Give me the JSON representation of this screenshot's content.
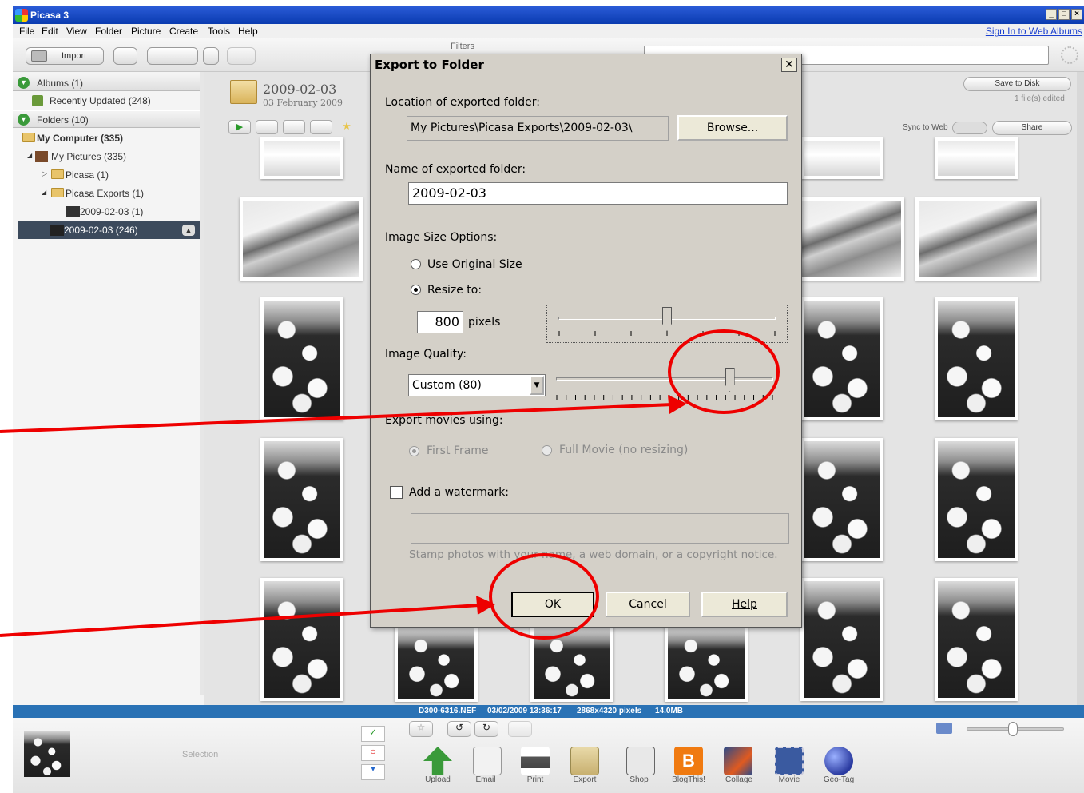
{
  "window": {
    "title": "Picasa 3"
  },
  "menu": {
    "items": [
      "File",
      "Edit",
      "View",
      "Folder",
      "Picture",
      "Create",
      "Tools",
      "Help"
    ],
    "sign_in": "Sign In to Web Albums"
  },
  "toolbar": {
    "import_label": "Import",
    "filters_label": "Filters"
  },
  "sidebar": {
    "albums_header": "Albums (1)",
    "recently_updated": "Recently Updated (248)",
    "folders_header": "Folders (10)",
    "my_computer": "My Computer (335)",
    "my_pictures": "My Pictures (335)",
    "picasa": "Picasa (1)",
    "picasa_exports": "Picasa Exports (1)",
    "exports_folder": "2009-02-03 (1)",
    "selected_folder": "2009-02-03 (246)"
  },
  "folder_view": {
    "title": "2009-02-03",
    "subtitle": "03 February 2009",
    "save_to_disk": "Save to Disk",
    "files_edited": "1 file(s) edited",
    "sync_to_web": "Sync to Web",
    "share": "Share"
  },
  "status": {
    "filename": "D300-6316.NEF",
    "datetime": "03/02/2009 13:36:17",
    "dimensions": "2868x4320 pixels",
    "size": "14.0MB"
  },
  "tray": {
    "selection_label": "Selection",
    "actions": [
      "Upload",
      "Email",
      "Print",
      "Export",
      "Shop",
      "BlogThis!",
      "Collage",
      "Movie",
      "Geo-Tag"
    ]
  },
  "dialog": {
    "title": "Export to Folder",
    "location_label": "Location of exported folder:",
    "location_value": "My Pictures\\Picasa Exports\\2009-02-03\\",
    "browse_button": "Browse...",
    "name_label": "Name of exported folder:",
    "name_value": "2009-02-03",
    "size_options_label": "Image Size Options:",
    "use_original": "Use Original Size",
    "resize_to": "Resize to:",
    "pixels_value": "800",
    "pixels_unit": "pixels",
    "resize_slider_fraction": 0.5,
    "quality_label": "Image Quality:",
    "quality_value": "Custom (80)",
    "quality_slider_fraction": 0.8,
    "movies_label": "Export movies using:",
    "first_frame": "First Frame",
    "full_movie": "Full Movie (no resizing)",
    "watermark_label": "Add a watermark:",
    "watermark_hint": "Stamp photos with your name, a web domain, or a copyright notice.",
    "ok_button": "OK",
    "cancel_button": "Cancel",
    "help_button": "Help"
  },
  "colors": {
    "annotation": "#e00000",
    "titlebar": "#0a3bb0",
    "status_bar": "#2a72b5",
    "selected_row": "#3c4a5c"
  }
}
